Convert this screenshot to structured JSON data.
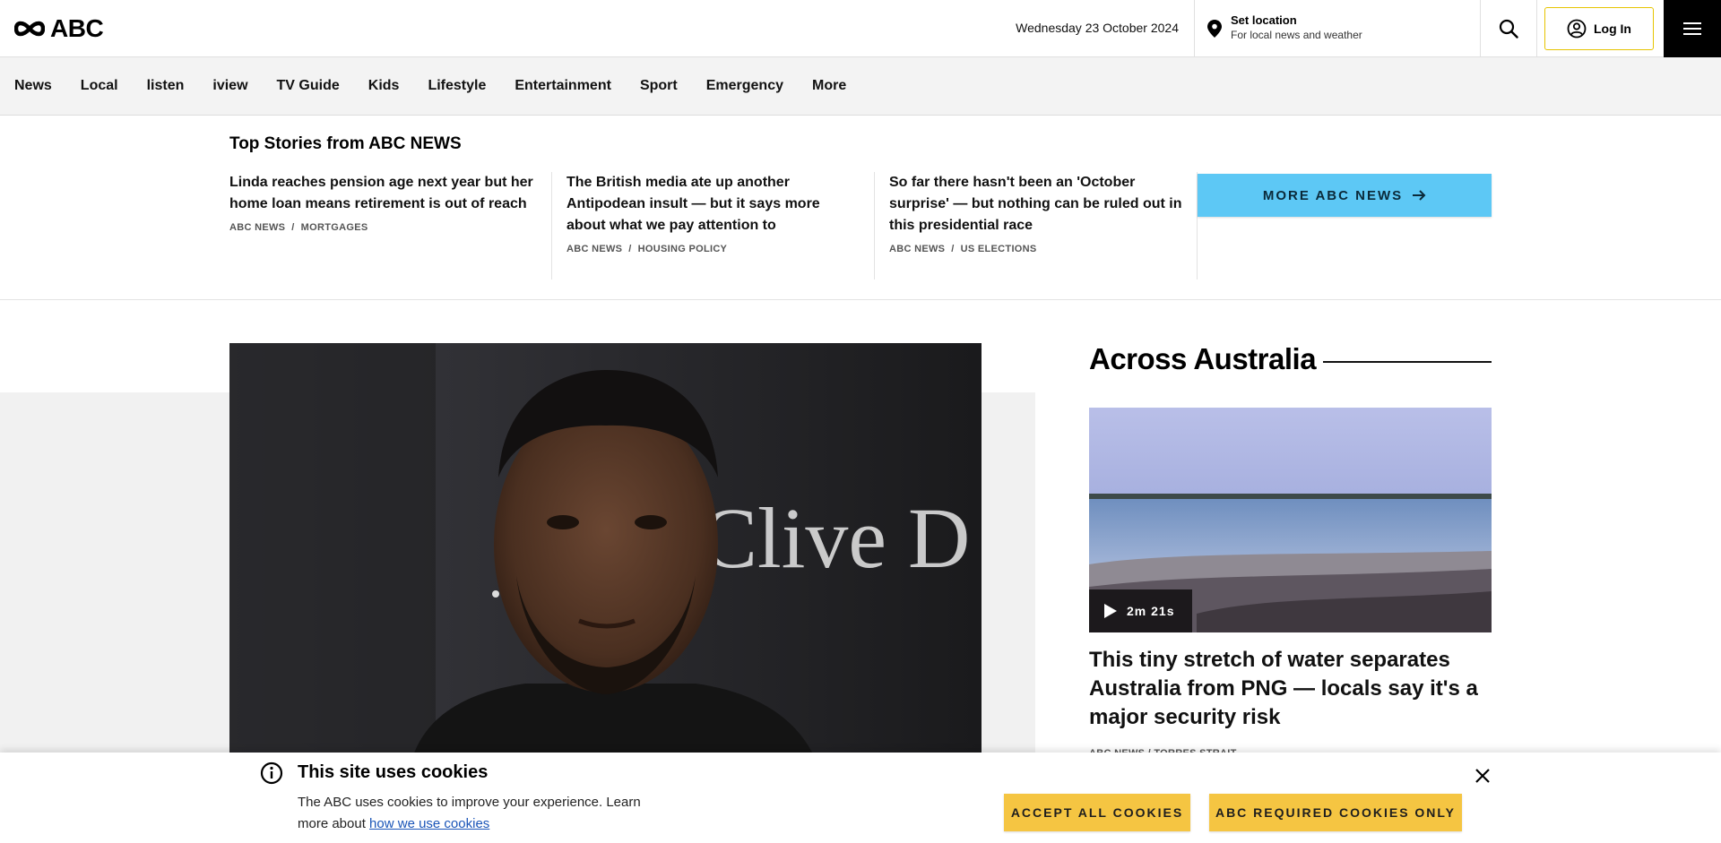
{
  "header": {
    "logo_text": "ABC",
    "date": "Wednesday 23 October 2024",
    "location": {
      "title": "Set location",
      "subtitle": "For local news and weather"
    },
    "login_label": "Log In",
    "icons": {
      "logo": "abc-logo-icon",
      "location": "location-pin-icon",
      "search": "search-icon",
      "user": "user-circle-icon",
      "menu": "hamburger-menu-icon"
    }
  },
  "nav": {
    "items": [
      "News",
      "Local",
      "listen",
      "iview",
      "TV Guide",
      "Kids",
      "Lifestyle",
      "Entertainment",
      "Sport",
      "Emergency",
      "More"
    ]
  },
  "top_stories": {
    "title": "Top Stories from ABC NEWS",
    "items": [
      {
        "headline": "Linda reaches pension age next year but her home loan means retirement is out of reach",
        "source": "ABC NEWS",
        "topic": "MORTGAGES"
      },
      {
        "headline": "The British media ate up another Antipodean insult — but it says more about what we pay attention to",
        "source": "ABC NEWS",
        "topic": "HOUSING POLICY"
      },
      {
        "headline": "So far there hasn't been an 'October surprise' — but nothing can be ruled out in this presidential race",
        "source": "ABC NEWS",
        "topic": "US ELECTIONS"
      }
    ],
    "more_button": "MORE ABC NEWS"
  },
  "feature": {
    "image_backdrop_text": "Clive D"
  },
  "across_australia": {
    "title": "Across Australia",
    "video_duration": "2m 21s",
    "headline": "This tiny stretch of water separates Australia from PNG — locals say it's a major security risk",
    "meta": "ABC NEWS / TORRES STRAIT"
  },
  "cookie_banner": {
    "title": "This site uses cookies",
    "body": "The ABC uses cookies to improve your experience. Learn more about ",
    "link_text": "how we use cookies",
    "accept_all": "ACCEPT ALL COOKIES",
    "required_only": "ABC REQUIRED COOKIES ONLY",
    "icons": {
      "info": "info-icon",
      "close": "close-icon"
    }
  },
  "colors": {
    "more_button": "#5dc8f5",
    "cookie_button": "#f5c542",
    "login_border": "#e6c400",
    "nav_background": "#f3f3f3"
  }
}
